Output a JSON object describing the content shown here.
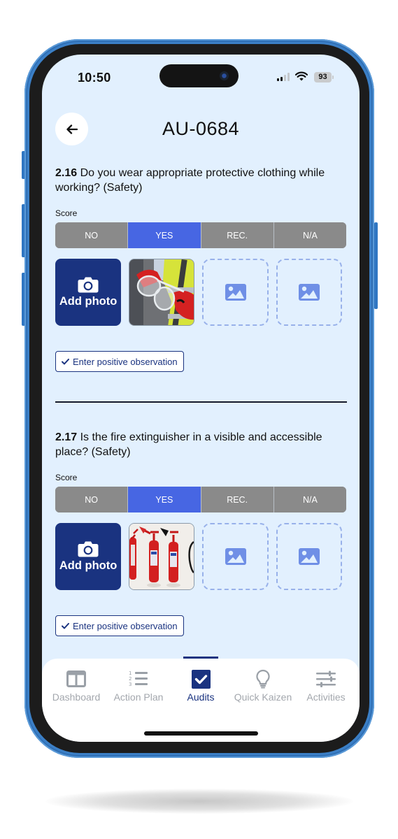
{
  "status_bar": {
    "time": "10:50",
    "battery": "93"
  },
  "header": {
    "title": "AU-0684",
    "back_icon": "arrow-left-icon"
  },
  "questions": [
    {
      "number": "2.16",
      "text": "Do you wear appropriate protective clothing while working? (Safety)",
      "score_label": "Score",
      "options": [
        "NO",
        "YES",
        "REC.",
        "N/A"
      ],
      "selected": "YES",
      "add_photo_label": "Add photo",
      "photo_description": "Gloved hands holding safety goggles, hi-vis vest",
      "empty_slots": 2,
      "observation_button": "Enter positive observation"
    },
    {
      "number": "2.17",
      "text": "Is the fire extinguisher in a visible and accessible place? (Safety)",
      "score_label": "Score",
      "options": [
        "NO",
        "YES",
        "REC.",
        "N/A"
      ],
      "selected": "YES",
      "add_photo_label": "Add photo",
      "photo_description": "Red fire extinguishers mounted on white wall",
      "empty_slots": 2,
      "observation_button": "Enter positive observation"
    }
  ],
  "tabbar": {
    "items": [
      {
        "label": "Dashboard",
        "icon": "dashboard-icon",
        "active": false
      },
      {
        "label": "Action Plan",
        "icon": "numbered-list-icon",
        "active": false
      },
      {
        "label": "Audits",
        "icon": "checkbox-icon",
        "active": true
      },
      {
        "label": "Quick Kaizen",
        "icon": "lightbulb-icon",
        "active": false
      },
      {
        "label": "Activities",
        "icon": "sliders-icon",
        "active": false
      }
    ]
  },
  "colors": {
    "screen_bg": "#e2f0fe",
    "primary": "#1a3380",
    "selected": "#4766e3",
    "unselected": "#8a8a8a",
    "frame": "#3b7fc6"
  }
}
